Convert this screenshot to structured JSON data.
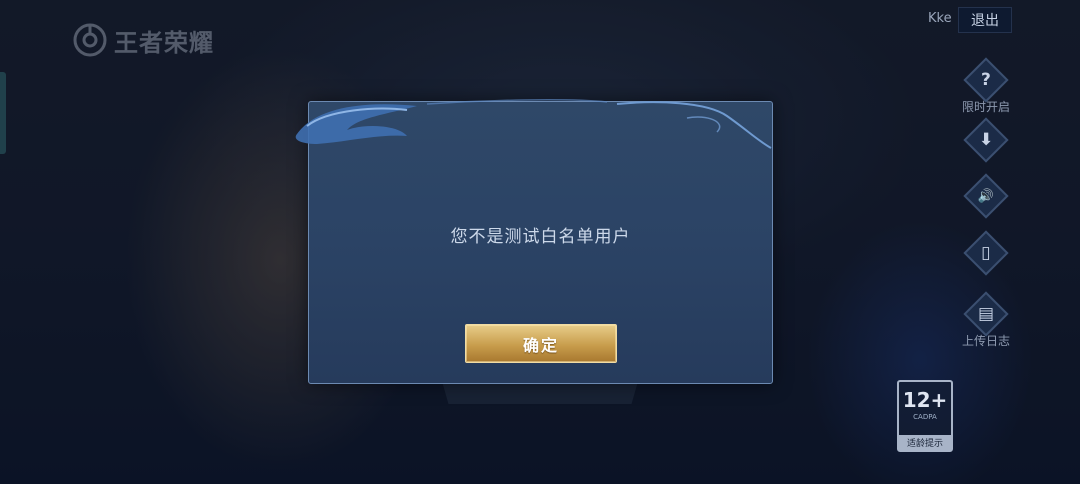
{
  "brand": {
    "logo_text": "王者荣耀"
  },
  "header": {
    "username": "Kke",
    "logout_label": "退出"
  },
  "side_menu": [
    {
      "icon": "question-icon",
      "glyph": "?",
      "label": "限时开启"
    },
    {
      "icon": "download-icon",
      "glyph": "⬇",
      "label": ""
    },
    {
      "icon": "speaker-icon",
      "glyph": "🔊",
      "label": ""
    },
    {
      "icon": "phone-icon",
      "glyph": "▯",
      "label": ""
    },
    {
      "icon": "clipboard-icon",
      "glyph": "▤",
      "label": "上传日志"
    }
  ],
  "age_rating": {
    "age": "12+",
    "org": "CADPA",
    "tip": "适龄提示"
  },
  "dialog": {
    "message": "您不是测试白名单用户",
    "confirm_label": "确定"
  },
  "colors": {
    "dialog_bg": "#2b4365",
    "confirm_gold": "#c89d4c",
    "accent_border": "#6c8ab2"
  }
}
